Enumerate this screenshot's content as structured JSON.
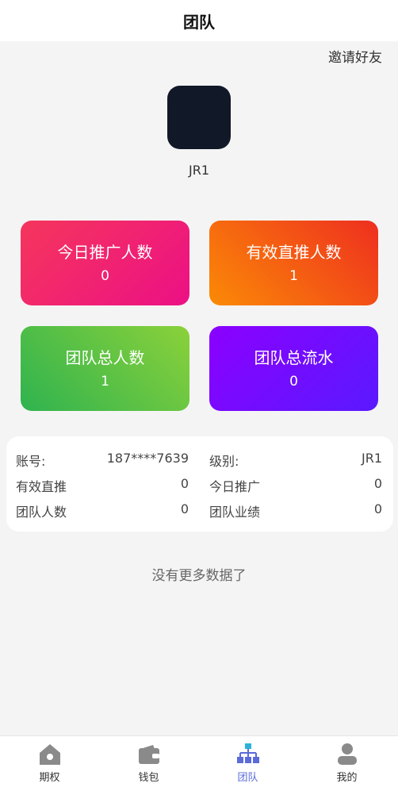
{
  "header": {
    "title": "团队"
  },
  "invite_label": "邀请好友",
  "profile": {
    "username": "JR1"
  },
  "stats": [
    {
      "label": "今日推广人数",
      "value": "0"
    },
    {
      "label": "有效直推人数",
      "value": "1"
    },
    {
      "label": "团队总人数",
      "value": "1"
    },
    {
      "label": "团队总流水",
      "value": "0"
    }
  ],
  "info": {
    "account_label": "账号:",
    "account_value": "187****7639",
    "level_label": "级别:",
    "level_value": "JR1",
    "direct_label": "有效直推",
    "direct_value": "0",
    "today_label": "今日推广",
    "today_value": "0",
    "team_count_label": "团队人数",
    "team_count_value": "0",
    "team_perf_label": "团队业绩",
    "team_perf_value": "0"
  },
  "no_more": "没有更多数据了",
  "tabs": [
    {
      "label": "期权",
      "icon": "home-icon"
    },
    {
      "label": "钱包",
      "icon": "wallet-icon"
    },
    {
      "label": "团队",
      "icon": "team-icon",
      "active": true
    },
    {
      "label": "我的",
      "icon": "user-icon"
    }
  ],
  "colors": {
    "active_tab": "#5b6bd9",
    "avatar": "#111827"
  }
}
